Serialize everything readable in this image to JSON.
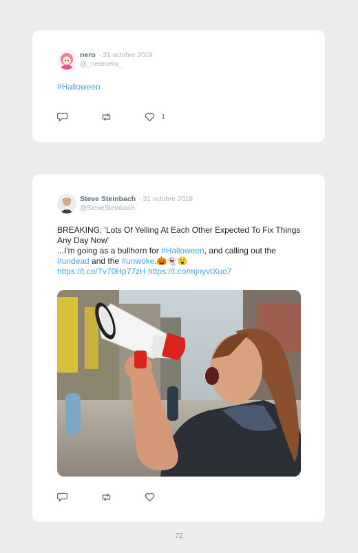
{
  "tweets": [
    {
      "name": "nero",
      "date": "· 31 octobre 2019",
      "handle": "@_neronero_",
      "text": "#Halloween",
      "likes": "1"
    },
    {
      "name": "Steve Steinbach",
      "date": "· 31 octobre 2019",
      "handle": "@SteveSteinbach",
      "line1": "BREAKING: 'Lots Of Yelling At Each Other Expected To Fix Things Any Day Now'",
      "line2_a": "...I'm going as a bullhorn for ",
      "line2_tag": "#Halloween",
      "line2_b": ", and calling out the",
      "line3_tag1": "#undead",
      "line3_and": " and the ",
      "line3_tag2": "#unwoke",
      "line3_emoji": ".🎃👻😮",
      "link1": "https://t.co/Tv70Hp77zH",
      "link2": "https://t.co/mjnyvtXuo7"
    }
  ],
  "page_number": "72",
  "colors": {
    "accent": "#4aa3df",
    "card": "#ffffff",
    "background": "#ececec"
  },
  "icons": [
    "reply-icon",
    "retweet-icon",
    "like-icon"
  ]
}
